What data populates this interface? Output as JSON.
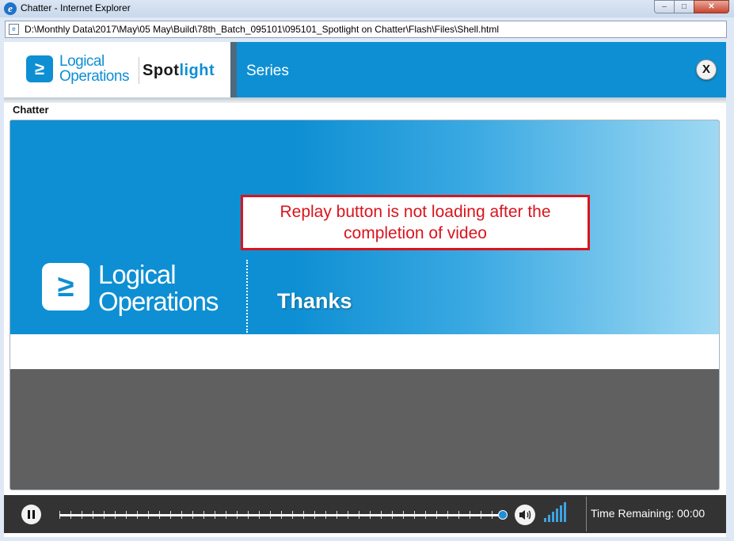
{
  "window": {
    "title": "Chatter - Internet Explorer",
    "browser_icon": "e",
    "minimize": "‒",
    "maximize": "□",
    "close": "✕"
  },
  "address": {
    "url": "D:\\Monthly Data\\2017\\May\\05 May\\Build\\78th_Batch_095101\\095101_Spotlight on Chatter\\Flash\\Files\\Shell.html"
  },
  "header": {
    "brand_line1": "Logical",
    "brand_line2": "Operations",
    "product_prefix": "Spot",
    "product_suffix": "light",
    "section": "Series",
    "close_label": "X"
  },
  "page": {
    "label": "Chatter"
  },
  "video": {
    "brand_line1": "Logical",
    "brand_line2": "Operations",
    "message": "Thanks",
    "annotation": "Replay button is not loading after the completion of video",
    "progress_fraction": 1.0
  },
  "controls": {
    "time_remaining": "Time Remaining: 00:00"
  },
  "colors": {
    "accent": "#0e8fd3",
    "annotation_red": "#d9141d",
    "controls_bg": "#333333"
  }
}
